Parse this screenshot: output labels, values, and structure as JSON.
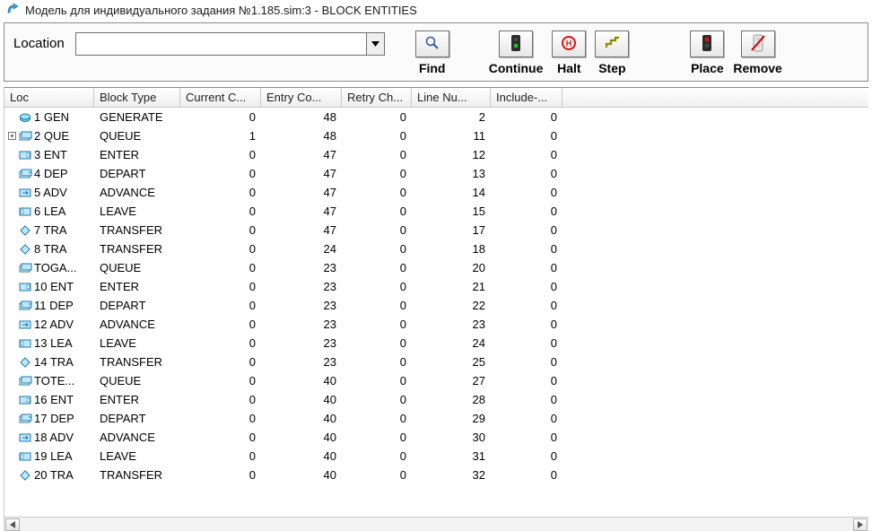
{
  "title": "Модель для индивидуального задания №1.185.sim:3  -  BLOCK ENTITIES",
  "toolbar": {
    "location_label": "Location",
    "location_value": "",
    "buttons": {
      "find": "Find",
      "continue": "Continue",
      "halt": "Halt",
      "step": "Step",
      "place": "Place",
      "remove": "Remove"
    }
  },
  "columns": {
    "loc": "Loc",
    "block_type": "Block Type",
    "current_c": "Current C...",
    "entry_co": "Entry Co...",
    "retry_ch": "Retry Ch...",
    "line_nu": "Line Nu...",
    "include": "Include-..."
  },
  "rows": [
    {
      "icon": "gen",
      "loc": "1 GEN",
      "bt": "GENERATE",
      "cc": 0,
      "ec": 48,
      "rc": 0,
      "ln": 2,
      "inc": 0,
      "exp": "none"
    },
    {
      "icon": "queue",
      "loc": "2 QUE",
      "bt": "QUEUE",
      "cc": 1,
      "ec": 48,
      "rc": 0,
      "ln": 11,
      "inc": 0,
      "exp": "plus"
    },
    {
      "icon": "enter",
      "loc": "3 ENT",
      "bt": "ENTER",
      "cc": 0,
      "ec": 47,
      "rc": 0,
      "ln": 12,
      "inc": 0,
      "exp": "none"
    },
    {
      "icon": "depart",
      "loc": "4 DEP",
      "bt": "DEPART",
      "cc": 0,
      "ec": 47,
      "rc": 0,
      "ln": 13,
      "inc": 0,
      "exp": "none"
    },
    {
      "icon": "adv",
      "loc": "5 ADV",
      "bt": "ADVANCE",
      "cc": 0,
      "ec": 47,
      "rc": 0,
      "ln": 14,
      "inc": 0,
      "exp": "none"
    },
    {
      "icon": "leave",
      "loc": "6 LEA",
      "bt": "LEAVE",
      "cc": 0,
      "ec": 47,
      "rc": 0,
      "ln": 15,
      "inc": 0,
      "exp": "none"
    },
    {
      "icon": "tra",
      "loc": "7 TRA",
      "bt": "TRANSFER",
      "cc": 0,
      "ec": 47,
      "rc": 0,
      "ln": 17,
      "inc": 0,
      "exp": "none"
    },
    {
      "icon": "tra",
      "loc": "8 TRA",
      "bt": "TRANSFER",
      "cc": 0,
      "ec": 24,
      "rc": 0,
      "ln": 18,
      "inc": 0,
      "exp": "none"
    },
    {
      "icon": "queue",
      "loc": "TOGA...",
      "bt": "QUEUE",
      "cc": 0,
      "ec": 23,
      "rc": 0,
      "ln": 20,
      "inc": 0,
      "exp": "none"
    },
    {
      "icon": "enter",
      "loc": "10 ENT",
      "bt": "ENTER",
      "cc": 0,
      "ec": 23,
      "rc": 0,
      "ln": 21,
      "inc": 0,
      "exp": "none"
    },
    {
      "icon": "depart",
      "loc": "11 DEP",
      "bt": "DEPART",
      "cc": 0,
      "ec": 23,
      "rc": 0,
      "ln": 22,
      "inc": 0,
      "exp": "none"
    },
    {
      "icon": "adv",
      "loc": "12 ADV",
      "bt": "ADVANCE",
      "cc": 0,
      "ec": 23,
      "rc": 0,
      "ln": 23,
      "inc": 0,
      "exp": "none"
    },
    {
      "icon": "leave",
      "loc": "13 LEA",
      "bt": "LEAVE",
      "cc": 0,
      "ec": 23,
      "rc": 0,
      "ln": 24,
      "inc": 0,
      "exp": "none"
    },
    {
      "icon": "tra",
      "loc": "14 TRA",
      "bt": "TRANSFER",
      "cc": 0,
      "ec": 23,
      "rc": 0,
      "ln": 25,
      "inc": 0,
      "exp": "none"
    },
    {
      "icon": "queue",
      "loc": "TOTE...",
      "bt": "QUEUE",
      "cc": 0,
      "ec": 40,
      "rc": 0,
      "ln": 27,
      "inc": 0,
      "exp": "none"
    },
    {
      "icon": "enter",
      "loc": "16 ENT",
      "bt": "ENTER",
      "cc": 0,
      "ec": 40,
      "rc": 0,
      "ln": 28,
      "inc": 0,
      "exp": "none"
    },
    {
      "icon": "depart",
      "loc": "17 DEP",
      "bt": "DEPART",
      "cc": 0,
      "ec": 40,
      "rc": 0,
      "ln": 29,
      "inc": 0,
      "exp": "none"
    },
    {
      "icon": "adv",
      "loc": "18 ADV",
      "bt": "ADVANCE",
      "cc": 0,
      "ec": 40,
      "rc": 0,
      "ln": 30,
      "inc": 0,
      "exp": "none"
    },
    {
      "icon": "leave",
      "loc": "19 LEA",
      "bt": "LEAVE",
      "cc": 0,
      "ec": 40,
      "rc": 0,
      "ln": 31,
      "inc": 0,
      "exp": "none"
    },
    {
      "icon": "tra",
      "loc": "20 TRA",
      "bt": "TRANSFER",
      "cc": 0,
      "ec": 40,
      "rc": 0,
      "ln": 32,
      "inc": 0,
      "exp": "none"
    }
  ]
}
